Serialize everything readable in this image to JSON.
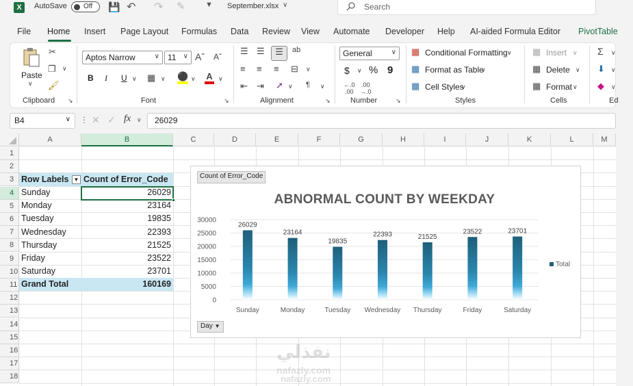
{
  "titlebar": {
    "autosave_label": "AutoSave",
    "autosave_state": "Off",
    "filename": "September.xlsx",
    "search_placeholder": "Search"
  },
  "menu": {
    "tabs": [
      "File",
      "Home",
      "Insert",
      "Page Layout",
      "Formulas",
      "Data",
      "Review",
      "View",
      "Automate",
      "Developer",
      "Help",
      "AI-aided Formula Editor",
      "PivotTable"
    ],
    "active": "Home"
  },
  "ribbon": {
    "clipboard": {
      "paste": "Paste",
      "label": "Clipboard"
    },
    "font": {
      "name": "Aptos Narrow",
      "size": "11",
      "label": "Font",
      "bold": "B",
      "italic": "I",
      "underline": "U"
    },
    "alignment": {
      "label": "Alignment"
    },
    "number": {
      "format": "General",
      "label": "Number",
      "currency": "$",
      "percent": "%",
      "comma": "9"
    },
    "styles": {
      "conditional": "Conditional Formatting",
      "format_table": "Format as Table",
      "cell_styles": "Cell Styles",
      "label": "Styles"
    },
    "cells": {
      "insert": "Insert",
      "delete": "Delete",
      "format": "Format",
      "label": "Cells"
    },
    "editing": {
      "label": "Ed"
    }
  },
  "formula_bar": {
    "name_box": "B4",
    "fx": "fx",
    "value": "26029"
  },
  "sheet": {
    "columns": [
      "A",
      "B",
      "C",
      "D",
      "E",
      "F",
      "G",
      "H",
      "I",
      "J",
      "K",
      "L",
      "M"
    ],
    "row_numbers": [
      "1",
      "2",
      "3",
      "4",
      "5",
      "6",
      "7",
      "8",
      "9",
      "10",
      "11",
      "12",
      "13",
      "14",
      "15",
      "16",
      "17",
      "18"
    ],
    "pivot_header": {
      "row_labels": "Row Labels",
      "count": "Count of Error_Code"
    },
    "pivot_rows": [
      {
        "label": "Sunday",
        "value": "26029"
      },
      {
        "label": "Monday",
        "value": "23164"
      },
      {
        "label": "Tuesday",
        "value": "19835"
      },
      {
        "label": "Wednesday",
        "value": "22393"
      },
      {
        "label": "Thursday",
        "value": "21525"
      },
      {
        "label": "Friday",
        "value": "23522"
      },
      {
        "label": "Saturday",
        "value": "23701"
      }
    ],
    "grand_total": {
      "label": "Grand Total",
      "value": "160169"
    }
  },
  "chart_field_button": "Count of Error_Code",
  "day_button": "Day",
  "chart_data": {
    "type": "bar",
    "title": "ABNORMAL COUNT BY WEEKDAY",
    "categories": [
      "Sunday",
      "Monday",
      "Tuesday",
      "Wednesday",
      "Thursday",
      "Friday",
      "Saturday"
    ],
    "series": [
      {
        "name": "Total",
        "values": [
          26029,
          23164,
          19835,
          22393,
          21525,
          23522,
          23701
        ]
      }
    ],
    "ylim": [
      0,
      30000
    ],
    "yticks": [
      0,
      5000,
      10000,
      15000,
      20000,
      25000,
      30000
    ],
    "legend": "right",
    "bar_color": "#1f5f7a"
  },
  "watermark": {
    "arabic": "نفذلي",
    "line1": "nafazly.com",
    "line2": "nafazly.com"
  }
}
